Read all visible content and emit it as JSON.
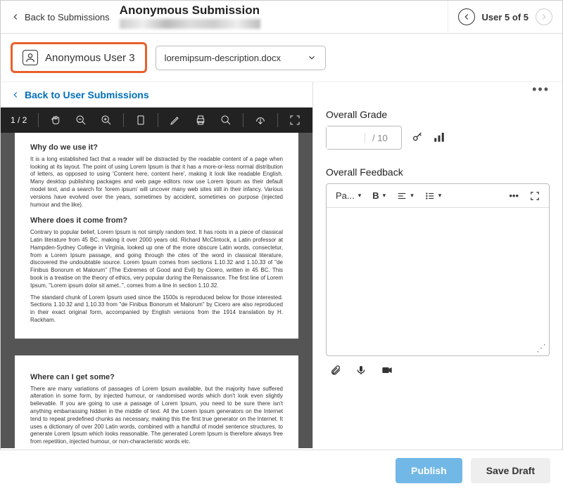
{
  "header": {
    "back_label": "Back to Submissions",
    "title": "Anonymous Submission",
    "user_counter": "User 5 of 5"
  },
  "user_row": {
    "user_name": "Anonymous User 3",
    "file_name": "loremipsum-description.docx"
  },
  "left": {
    "back_user_label": "Back to User Submissions",
    "page_counter": "1 / 2",
    "doc": {
      "h1": "Why do we use it?",
      "p1": "It is a long established fact that a reader will be distracted by the readable content of a page when looking at its layout. The point of using Lorem Ipsum is that it has a more-or-less normal distribution of letters, as opposed to using 'Content here, content here', making it look like readable English. Many desktop publishing packages and web page editors now use Lorem Ipsum as their default model text, and a search for 'lorem ipsum' will uncover many web sites still in their infancy. Various versions have evolved over the years, sometimes by accident, sometimes on purpose (injected humour and the like).",
      "h2": "Where does it come from?",
      "p2": "Contrary to popular belief, Lorem Ipsum is not simply random text. It has roots in a piece of classical Latin literature from 45 BC, making it over 2000 years old. Richard McClintock, a Latin professor at Hampden-Sydney College in Virginia, looked up one of the more obscure Latin words, consectetur, from a Lorem Ipsum passage, and going through the cites of the word in classical literature, discovered the undoubtable source. Lorem Ipsum comes from sections 1.10.32 and 1.10.33 of \"de Finibus Bonorum et Malorum\" (The Extremes of Good and Evil) by Cicero, written in 45 BC. This book is a treatise on the theory of ethics, very popular during the Renaissance. The first line of Lorem Ipsum, \"Lorem ipsum dolor sit amet..\", comes from a line in section 1.10.32.",
      "p3": "The standard chunk of Lorem Ipsum used since the 1500s is reproduced below for those interested. Sections 1.10.32 and 1.10.33 from \"de Finibus Bonorum et Malorum\" by Cicero are also reproduced in their exact original form, accompanied by English versions from the 1914 translation by H. Rackham.",
      "h3": "Where can I get some?",
      "p4": "There are many variations of passages of Lorem Ipsum available, but the majority have suffered alteration in some form, by injected humour, or randomised words which don't look even slightly believable. If you are going to use a passage of Lorem Ipsum, you need to be sure there isn't anything embarrassing hidden in the middle of text. All the Lorem Ipsum generators on the Internet tend to repeat predefined chunks as necessary, making this the first true generator on the Internet. It uses a dictionary of over 200 Latin words, combined with a handful of model sentence structures, to generate Lorem Ipsum which looks reasonable. The generated Lorem Ipsum is therefore always free from repetition, injected humour, or non-characteristic words etc."
    }
  },
  "right": {
    "grade_label": "Overall Grade",
    "grade_max": "/ 10",
    "feedback_label": "Overall Feedback",
    "para_label": "Pa..."
  },
  "footer": {
    "publish": "Publish",
    "save_draft": "Save Draft"
  }
}
